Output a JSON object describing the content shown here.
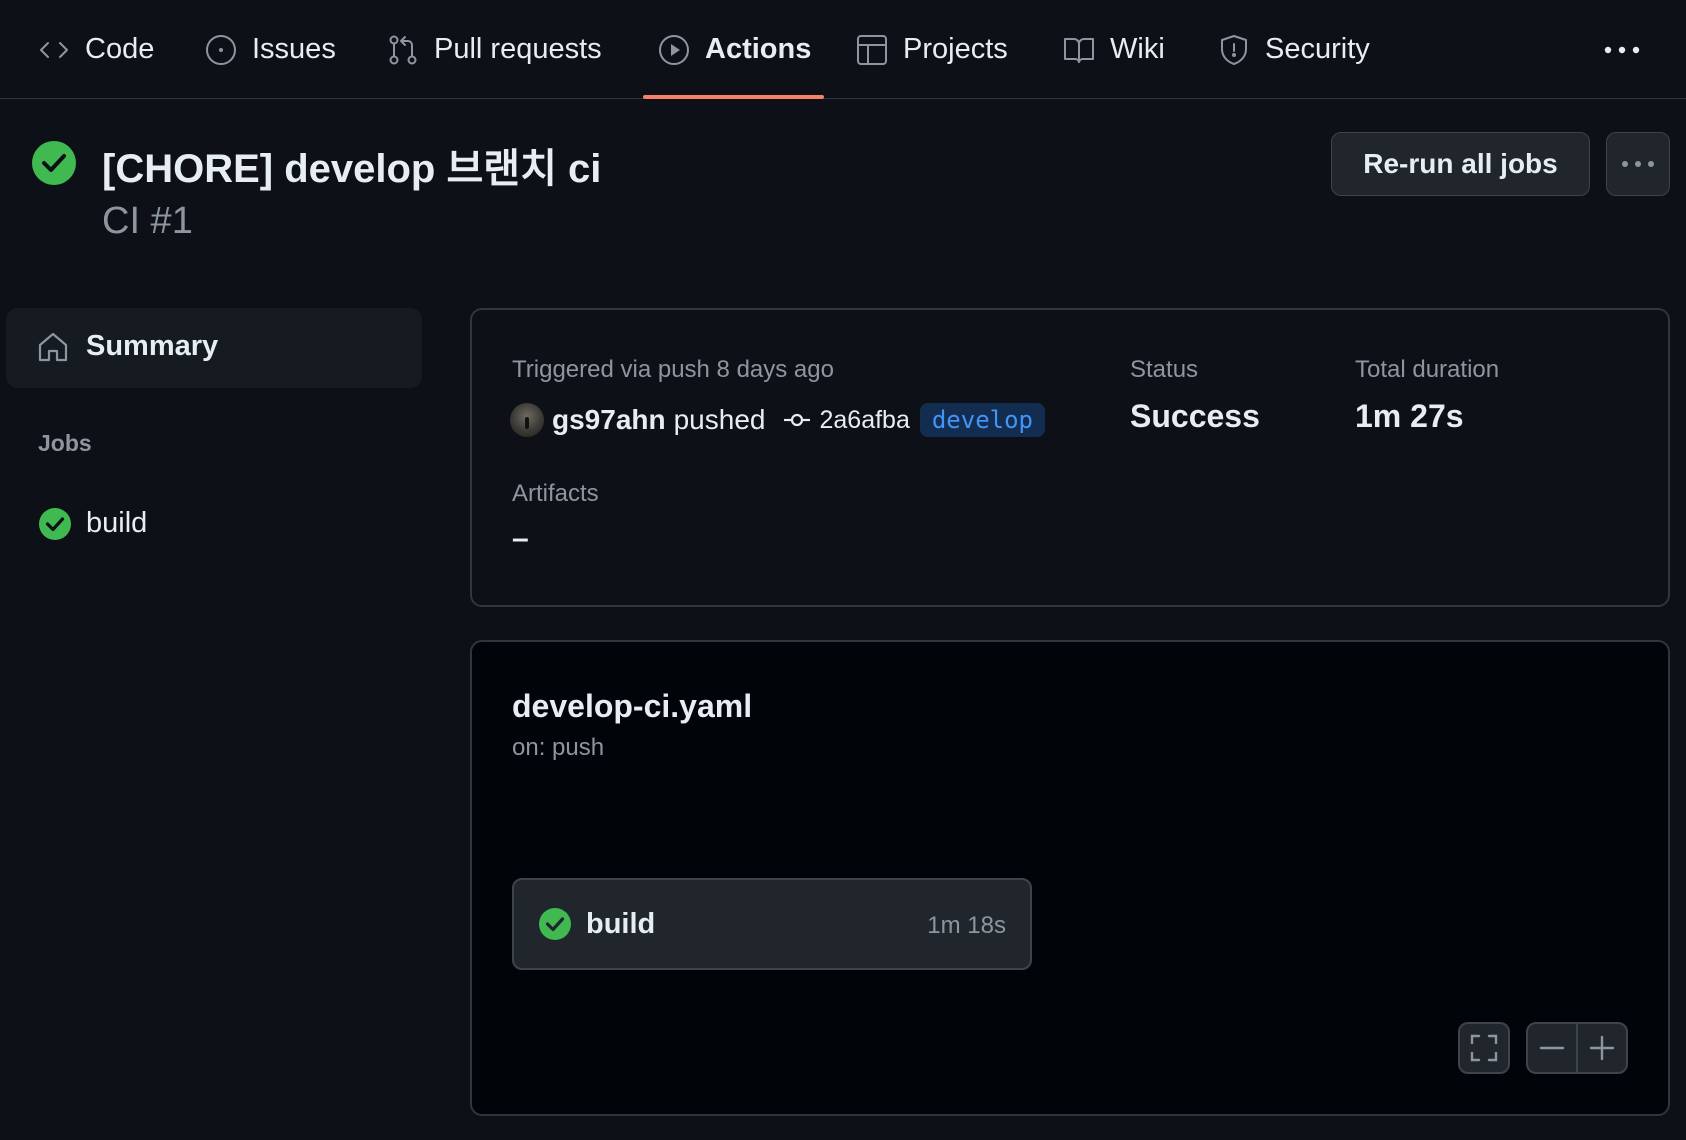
{
  "colors": {
    "background": "#0d1117",
    "graph_background": "#010409",
    "success": "#3fb950",
    "accent_underline": "#f78166",
    "branch_text": "#4493f8",
    "branch_bg": "#122d4f"
  },
  "repo_nav": {
    "tabs": [
      {
        "label": "Code",
        "icon": "code-icon",
        "active": false
      },
      {
        "label": "Issues",
        "icon": "issue-opened-icon",
        "active": false
      },
      {
        "label": "Pull requests",
        "icon": "git-pull-request-icon",
        "active": false
      },
      {
        "label": "Actions",
        "icon": "play-icon",
        "active": true
      },
      {
        "label": "Projects",
        "icon": "table-icon",
        "active": false
      },
      {
        "label": "Wiki",
        "icon": "book-icon",
        "active": false
      },
      {
        "label": "Security",
        "icon": "shield-icon",
        "active": false
      }
    ],
    "more_icon": "kebab-horizontal-icon"
  },
  "run": {
    "status_icon": "check-circle-fill-icon",
    "title": "[CHORE] develop 브랜치 ci",
    "subtitle": "CI #1",
    "rerun_label": "Re-run all jobs",
    "more_icon": "kebab-horizontal-icon"
  },
  "sidebar": {
    "summary_label": "Summary",
    "summary_icon": "home-icon",
    "jobs_heading": "Jobs",
    "jobs": [
      {
        "name": "build",
        "status_icon": "check-circle-fill-icon"
      }
    ]
  },
  "summary": {
    "trigger_text": "Triggered via push 8 days ago",
    "actor": "gs97ahn",
    "action": "pushed",
    "commit_icon": "git-commit-icon",
    "commit_sha": "2a6afba",
    "branch": "develop",
    "status_label": "Status",
    "status_value": "Success",
    "duration_label": "Total duration",
    "duration_value": "1m 27s",
    "artifacts_label": "Artifacts",
    "artifacts_value": "–"
  },
  "workflow": {
    "file": "develop-ci.yaml",
    "trigger": "on: push",
    "jobs": [
      {
        "name": "build",
        "duration": "1m 18s",
        "status_icon": "check-circle-fill-icon"
      }
    ],
    "controls": [
      "fullscreen-icon",
      "dash-icon",
      "plus-icon"
    ]
  }
}
